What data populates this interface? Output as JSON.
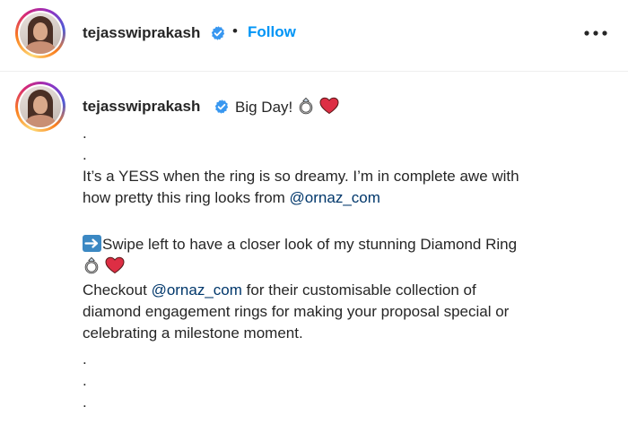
{
  "header": {
    "username": "tejasswiprakash",
    "separator": "•",
    "follow_label": "Follow"
  },
  "caption": {
    "username": "tejasswiprakash",
    "first_line": "Big Day!",
    "lines": [
      ".",
      ".",
      "It’s a YESS when the ring is so dreamy. I’m in complete awe with",
      "how pretty this ring looks from",
      "Swipe left to have a closer look of my stunning Diamond Ring",
      "Checkout",
      "for their customisable collection of",
      "diamond engagement rings for making your proposal special or",
      "celebrating a milestone moment.",
      ".",
      ".",
      "."
    ],
    "mention": "@ornaz_com"
  },
  "colors": {
    "accent": "#0095f6",
    "mention": "#00376b",
    "verified": "#3897f0",
    "heart": "#dd2e44",
    "arrow_box": "#3b88c3"
  },
  "icons": {
    "more": "more-horizontal-icon",
    "verified": "verified-badge-icon",
    "ring": "ring-emoji-icon",
    "heart": "heart-emoji-icon",
    "arrow": "right-arrow-emoji-icon"
  }
}
